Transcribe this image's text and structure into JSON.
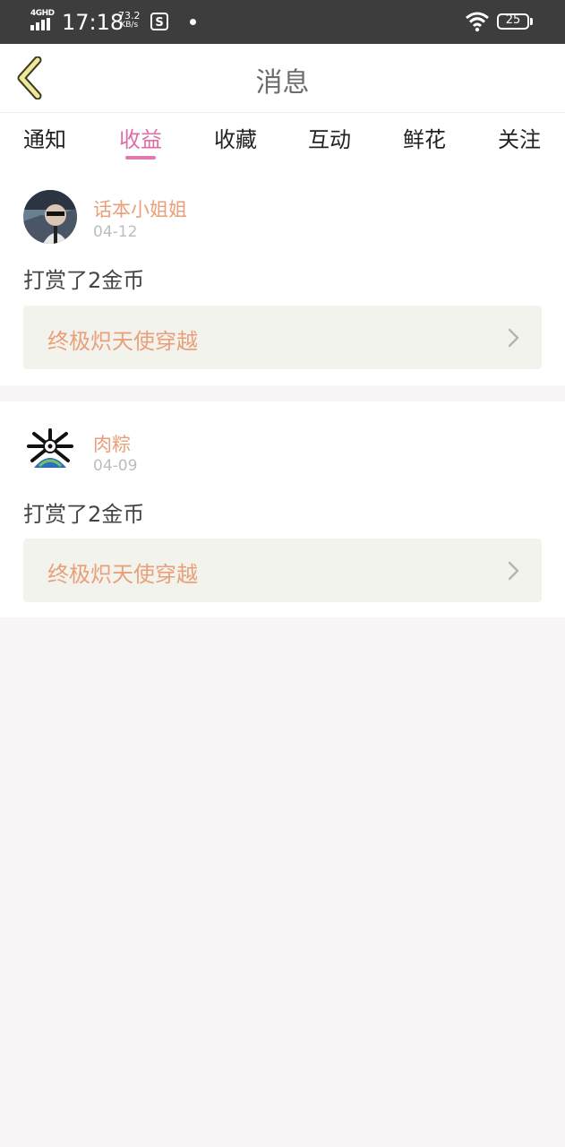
{
  "status_bar": {
    "network": "4GHD",
    "time": "17:18",
    "speed_value": "73.2",
    "speed_unit": "KB/s",
    "battery": "25"
  },
  "header": {
    "title": "消息",
    "back_icon": "chevron-left-icon"
  },
  "tabs": [
    {
      "label": "通知",
      "active": false
    },
    {
      "label": "收益",
      "active": true
    },
    {
      "label": "收藏",
      "active": false
    },
    {
      "label": "互动",
      "active": false
    },
    {
      "label": "鲜花",
      "active": false
    },
    {
      "label": "关注",
      "active": false
    }
  ],
  "messages": [
    {
      "username": "话本小姐姐",
      "date": "04-12",
      "text": "打赏了2金币",
      "book_title": "终极炽天使穿越"
    },
    {
      "username": "肉粽",
      "date": "04-09",
      "text": "打赏了2金币",
      "book_title": "终极炽天使穿越"
    }
  ],
  "colors": {
    "accent_pink": "#dd6fa7",
    "username_orange": "#e9a07a",
    "book_bg": "#f3f3ed",
    "page_bg": "#f8f6f6"
  }
}
